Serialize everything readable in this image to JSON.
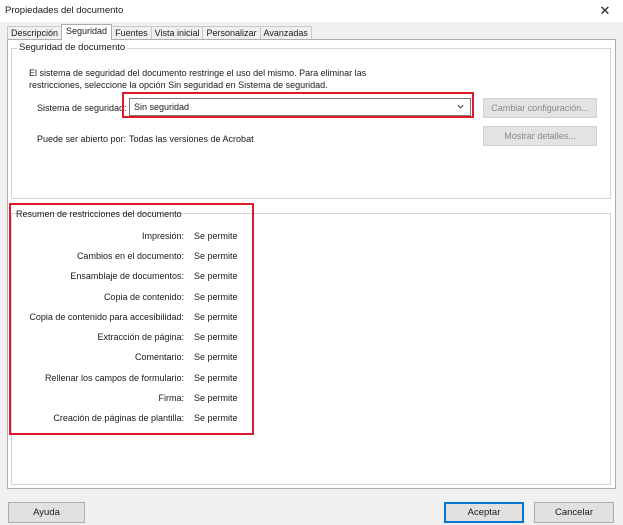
{
  "window": {
    "title": "Propiedades del documento",
    "close_glyph": "✕"
  },
  "tabs": [
    {
      "label": "Descripción",
      "active": false
    },
    {
      "label": "Seguridad",
      "active": true
    },
    {
      "label": "Fuentes",
      "active": false
    },
    {
      "label": "Vista inicial",
      "active": false
    },
    {
      "label": "Personalizar",
      "active": false
    },
    {
      "label": "Avanzadas",
      "active": false
    }
  ],
  "security_group": {
    "title": "Seguridad de documento",
    "description": "El sistema de seguridad del documento restringe el uso del mismo. Para eliminar las restricciones, seleccione la opción Sin seguridad en Sistema de seguridad.",
    "system_label": "Sistema de seguridad:",
    "system_value": "Sin seguridad",
    "change_button": "Cambiar configuración...",
    "open_label": "Puede ser abierto por:",
    "open_value": "Todas las versiones de Acrobat",
    "details_button": "Mostrar detalles..."
  },
  "summary": {
    "title": "Resumen de restricciones del documento",
    "rows": [
      {
        "label": "Impresión:",
        "value": "Se permite"
      },
      {
        "label": "Cambios en el documento:",
        "value": "Se permite"
      },
      {
        "label": "Ensamblaje de documentos:",
        "value": "Se permite"
      },
      {
        "label": "Copia de contenido:",
        "value": "Se permite"
      },
      {
        "label": "Copia de contenido para accesibilidad:",
        "value": "Se permite"
      },
      {
        "label": "Extracción de página:",
        "value": "Se permite"
      },
      {
        "label": "Comentario:",
        "value": "Se permite"
      },
      {
        "label": "Rellenar los campos de formulario:",
        "value": "Se permite"
      },
      {
        "label": "Firma:",
        "value": "Se permite"
      },
      {
        "label": "Creación de páginas de plantilla:",
        "value": "Se permite"
      }
    ]
  },
  "footer": {
    "help": "Ayuda",
    "accept": "Aceptar",
    "cancel": "Cancelar"
  },
  "colors": {
    "highlight": "#e0192a",
    "accent": "#0078d7"
  }
}
